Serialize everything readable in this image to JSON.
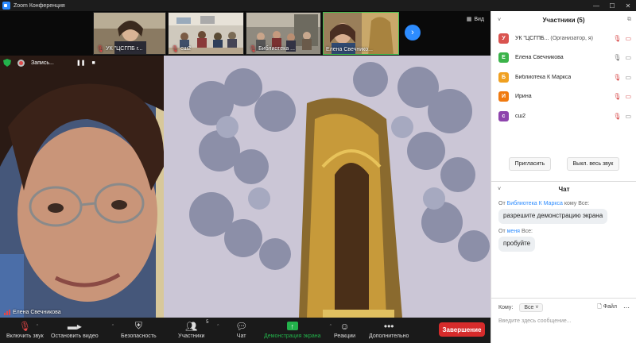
{
  "window": {
    "title": "Zoom Конференция"
  },
  "thumbnails": [
    {
      "name": "УК \"ЦСГПБ г...",
      "muted": true
    },
    {
      "name": "сш2",
      "muted": true
    },
    {
      "name": "Библиотека ...",
      "muted": true
    },
    {
      "name": "Елена Свечнико...",
      "muted": false
    }
  ],
  "view_label": "Вид",
  "recording": {
    "label": "Запись..."
  },
  "speaker": {
    "name": "Елена Свечникова"
  },
  "toolbar": {
    "audio": "Включить звук",
    "video": "Остановить видео",
    "security": "Безопасность",
    "participants": "Участники",
    "participants_count": "5",
    "chat": "Чат",
    "share": "Демонстрация экрана",
    "reactions": "Реакции",
    "more": "Дополнительно",
    "end": "Завершение"
  },
  "participants_panel": {
    "title": "Участники (5)",
    "people": [
      {
        "initial": "У",
        "name": "УК \"ЦСГПБ...",
        "role": "(Организатор, я)",
        "color": "#d9534f"
      },
      {
        "initial": "Е",
        "name": "Елена Свечникова",
        "role": "",
        "color": "#3bb34a"
      },
      {
        "initial": "Б",
        "name": "Библиотека К Маркса",
        "role": "",
        "color": "#f0a020"
      },
      {
        "initial": "И",
        "name": "Ирина",
        "role": "",
        "color": "#f07a10"
      },
      {
        "initial": "с",
        "name": "сш2",
        "role": "",
        "color": "#8e44ad"
      }
    ],
    "invite": "Пригласить",
    "mute_all": "Выкл. весь звук"
  },
  "chat": {
    "title": "Чат",
    "messages": [
      {
        "from_prefix": "От",
        "from": "Библиотека К Маркса",
        "to_text": "кому Все:",
        "text": "разрешите демонстрацию экрана"
      },
      {
        "from_prefix": "От",
        "from": "меня",
        "to_text": "Все:",
        "text": "пробуйте"
      }
    ],
    "to_label": "Кому:",
    "to_value": "Все",
    "file_label": "Файл",
    "placeholder": "Введите здесь сообщение..."
  },
  "colors": {
    "accent": "#2d8cff",
    "end": "#d62b2b",
    "share": "#23b24b",
    "muted": "#d64545"
  }
}
